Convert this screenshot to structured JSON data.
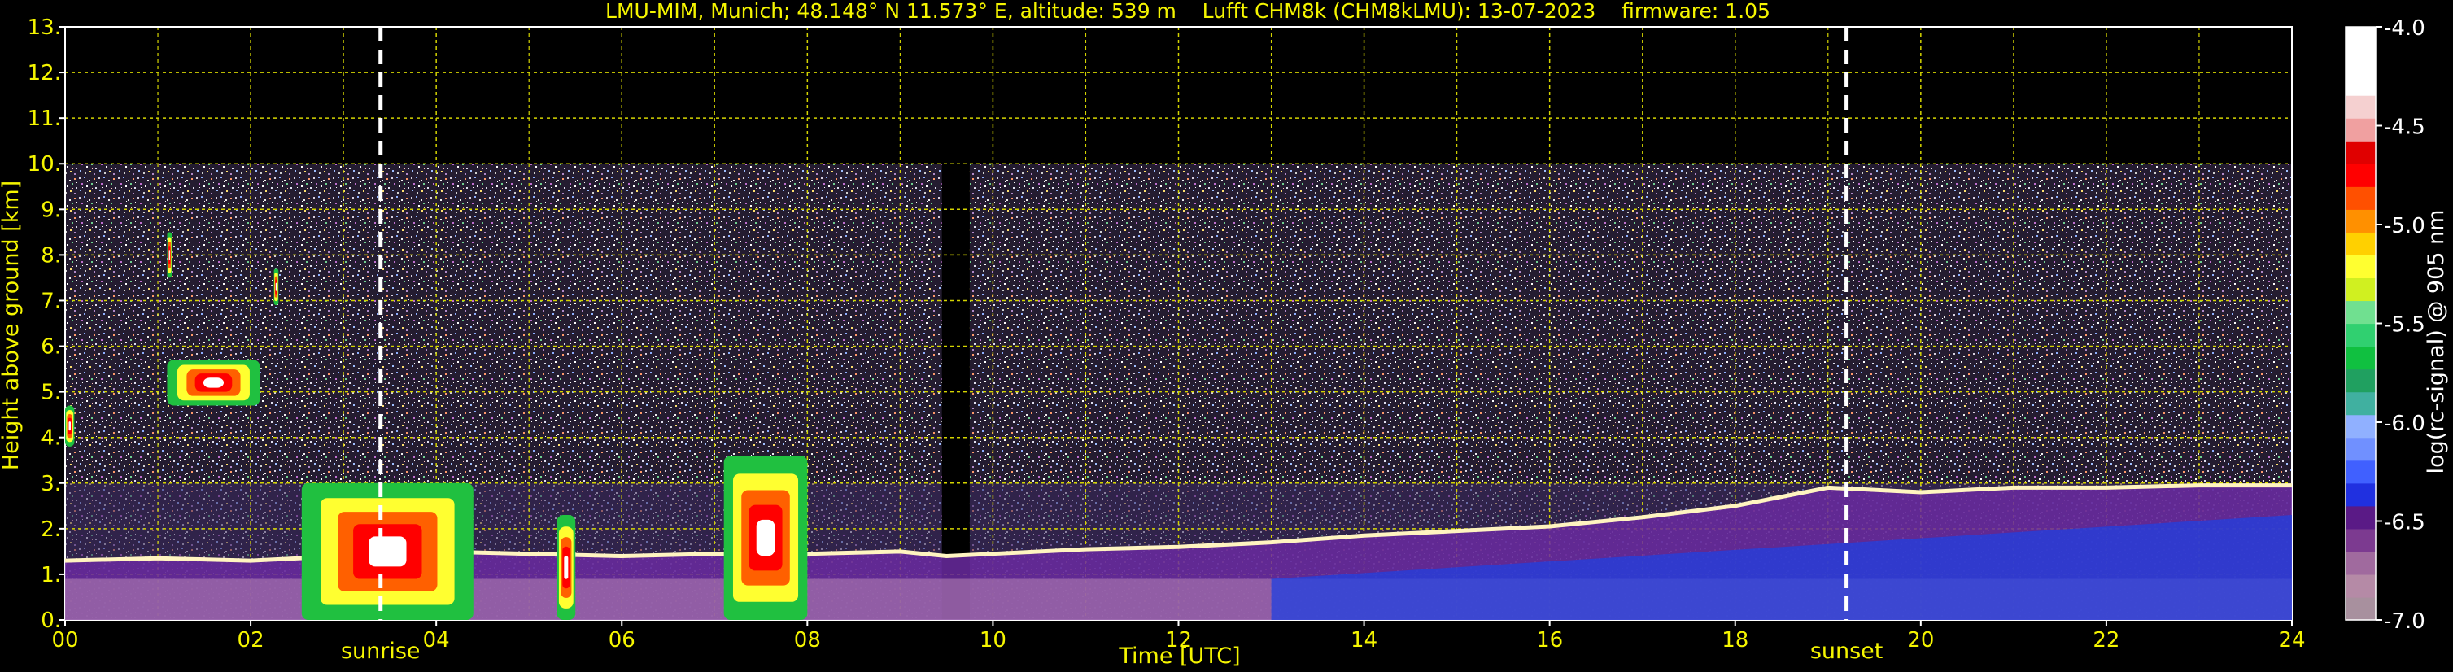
{
  "chart_data": {
    "type": "heatmap",
    "title": "LMU-MIM, Munich; 48.148° N 11.573° E, altitude: 539 m    Lufft CHM8k (CHM8kLMU): 13-07-2023    firmware: 1.05",
    "xlabel": "Time [UTC]",
    "ylabel": "Height above ground [km]",
    "xlim": [
      0,
      24
    ],
    "ylim": [
      0,
      13
    ],
    "x_ticks": [
      {
        "v": 0,
        "label": "00"
      },
      {
        "v": 2,
        "label": "02"
      },
      {
        "v": 4,
        "label": "04"
      },
      {
        "v": 6,
        "label": "06"
      },
      {
        "v": 8,
        "label": "08"
      },
      {
        "v": 10,
        "label": "10"
      },
      {
        "v": 12,
        "label": "12"
      },
      {
        "v": 14,
        "label": "14"
      },
      {
        "v": 16,
        "label": "16"
      },
      {
        "v": 18,
        "label": "18"
      },
      {
        "v": 20,
        "label": "20"
      },
      {
        "v": 22,
        "label": "22"
      },
      {
        "v": 24,
        "label": "24"
      }
    ],
    "y_ticks": [
      {
        "v": 0,
        "label": "0."
      },
      {
        "v": 1,
        "label": "1."
      },
      {
        "v": 2,
        "label": "2."
      },
      {
        "v": 3,
        "label": "3."
      },
      {
        "v": 4,
        "label": "4."
      },
      {
        "v": 5,
        "label": "5."
      },
      {
        "v": 6,
        "label": "6."
      },
      {
        "v": 7,
        "label": "7."
      },
      {
        "v": 8,
        "label": "8."
      },
      {
        "v": 9,
        "label": "9."
      },
      {
        "v": 10,
        "label": "10."
      },
      {
        "v": 11,
        "label": "11."
      },
      {
        "v": 12,
        "label": "12."
      },
      {
        "v": 13,
        "label": "13."
      }
    ],
    "grid": true,
    "measurement_top_km": 10,
    "data_gap": [
      9.45,
      9.75
    ],
    "annotations": [
      {
        "x": 3.4,
        "label": "sunrise"
      },
      {
        "x": 19.2,
        "label": "sunset"
      }
    ],
    "features": [
      {
        "kind": "boundary_layer",
        "points": [
          [
            0,
            1.3
          ],
          [
            1,
            1.35
          ],
          [
            2,
            1.3
          ],
          [
            3,
            1.4
          ],
          [
            4,
            1.5
          ],
          [
            5,
            1.45
          ],
          [
            6,
            1.4
          ],
          [
            7,
            1.45
          ],
          [
            8,
            1.45
          ],
          [
            9,
            1.5
          ],
          [
            9.5,
            1.4
          ],
          [
            10,
            1.45
          ],
          [
            11,
            1.55
          ],
          [
            12,
            1.6
          ],
          [
            13,
            1.7
          ],
          [
            14,
            1.85
          ],
          [
            15,
            1.95
          ],
          [
            16,
            2.05
          ],
          [
            17,
            2.25
          ],
          [
            18,
            2.5
          ],
          [
            19,
            2.9
          ],
          [
            20,
            2.8
          ],
          [
            21,
            2.9
          ],
          [
            22,
            2.9
          ],
          [
            23,
            2.95
          ],
          [
            24,
            2.95
          ]
        ]
      },
      {
        "kind": "cloud",
        "x": [
          0.0,
          0.1
        ],
        "y": [
          3.8,
          4.7
        ]
      },
      {
        "kind": "cloud",
        "x": [
          1.1,
          2.1
        ],
        "y": [
          4.7,
          5.7
        ]
      },
      {
        "kind": "cloud",
        "x": [
          2.55,
          4.4
        ],
        "y": [
          0,
          3.0
        ]
      },
      {
        "kind": "cloud",
        "x": [
          5.3,
          5.5
        ],
        "y": [
          0,
          2.3
        ]
      },
      {
        "kind": "cloud",
        "x": [
          7.1,
          8.0
        ],
        "y": [
          0,
          3.6
        ]
      },
      {
        "kind": "cloud",
        "x": [
          1.1,
          1.15
        ],
        "y": [
          7.5,
          8.5
        ]
      },
      {
        "kind": "cloud",
        "x": [
          2.25,
          2.3
        ],
        "y": [
          6.9,
          7.7
        ]
      }
    ],
    "colorbar": {
      "label": "log(rc-signal) @ 905 nm",
      "range": [
        -7.0,
        -4.0
      ],
      "ticks": [
        {
          "v": -4.0,
          "label": "-4.0"
        },
        {
          "v": -4.5,
          "label": "-4.5"
        },
        {
          "v": -5.0,
          "label": "-5.0"
        },
        {
          "v": -5.5,
          "label": "-5.5"
        },
        {
          "v": -6.0,
          "label": "-6.0"
        },
        {
          "v": -6.5,
          "label": "-6.5"
        },
        {
          "v": -7.0,
          "label": "-7.0"
        }
      ],
      "colors": [
        "#a8909e",
        "#b58aa6",
        "#a06a9e",
        "#7c3a90",
        "#5a1a86",
        "#2030e0",
        "#4060ff",
        "#7090ff",
        "#90b0ff",
        "#40b0a0",
        "#20a060",
        "#10c040",
        "#30d070",
        "#70e090",
        "#d0f020",
        "#ffff30",
        "#ffd000",
        "#ff9000",
        "#ff5000",
        "#ff0000",
        "#e00000",
        "#f0a0a0",
        "#f5d0d0",
        "#ffffff",
        "#ffffff",
        "#ffffff"
      ]
    },
    "colors": {
      "text": "#f5f500",
      "grid": "#d4d400",
      "background": "#000000",
      "noise": "#7a6a8a"
    }
  }
}
